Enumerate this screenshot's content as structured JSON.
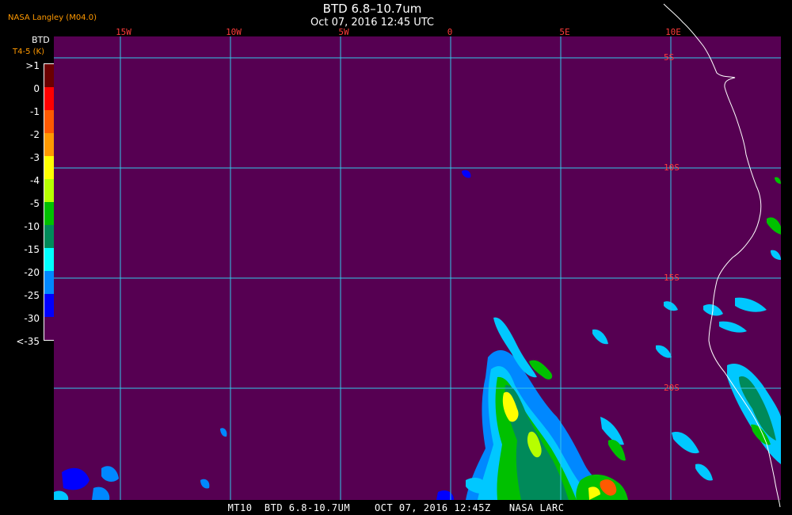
{
  "header": {
    "organization": "NASA Langley (M04.0)",
    "title": "BTD 6.8–10.7um",
    "datetime": "Oct 07, 2016 12:45 UTC"
  },
  "colorbar": {
    "label_top": "BTD",
    "label_units": "T4-5 (K)",
    "ticks": [
      ">1",
      "0",
      "-1",
      "-2",
      "-3",
      "-4",
      "-5",
      "-10",
      "-15",
      "-20",
      "-25",
      "-30",
      "<-35"
    ],
    "colors": [
      "#6b0000",
      "#ff0000",
      "#ff5a00",
      "#ff9900",
      "#ffff00",
      "#b6ff00",
      "#00c000",
      "#008a5a",
      "#00ffff",
      "#0088ff",
      "#0000ff",
      "#560052"
    ]
  },
  "map": {
    "background": "#560052",
    "grid_color": "#33c8e8",
    "coast_color": "#ffffff",
    "lon_labels": [
      "15W",
      "10W",
      "5W",
      "0",
      "5E",
      "10E"
    ],
    "lat_labels": [
      "5S",
      "10S",
      "15S",
      "20S"
    ]
  },
  "footer": "MT10  BTD 6.8-10.7UM    OCT 07, 2016 12:45Z   NASA LARC"
}
